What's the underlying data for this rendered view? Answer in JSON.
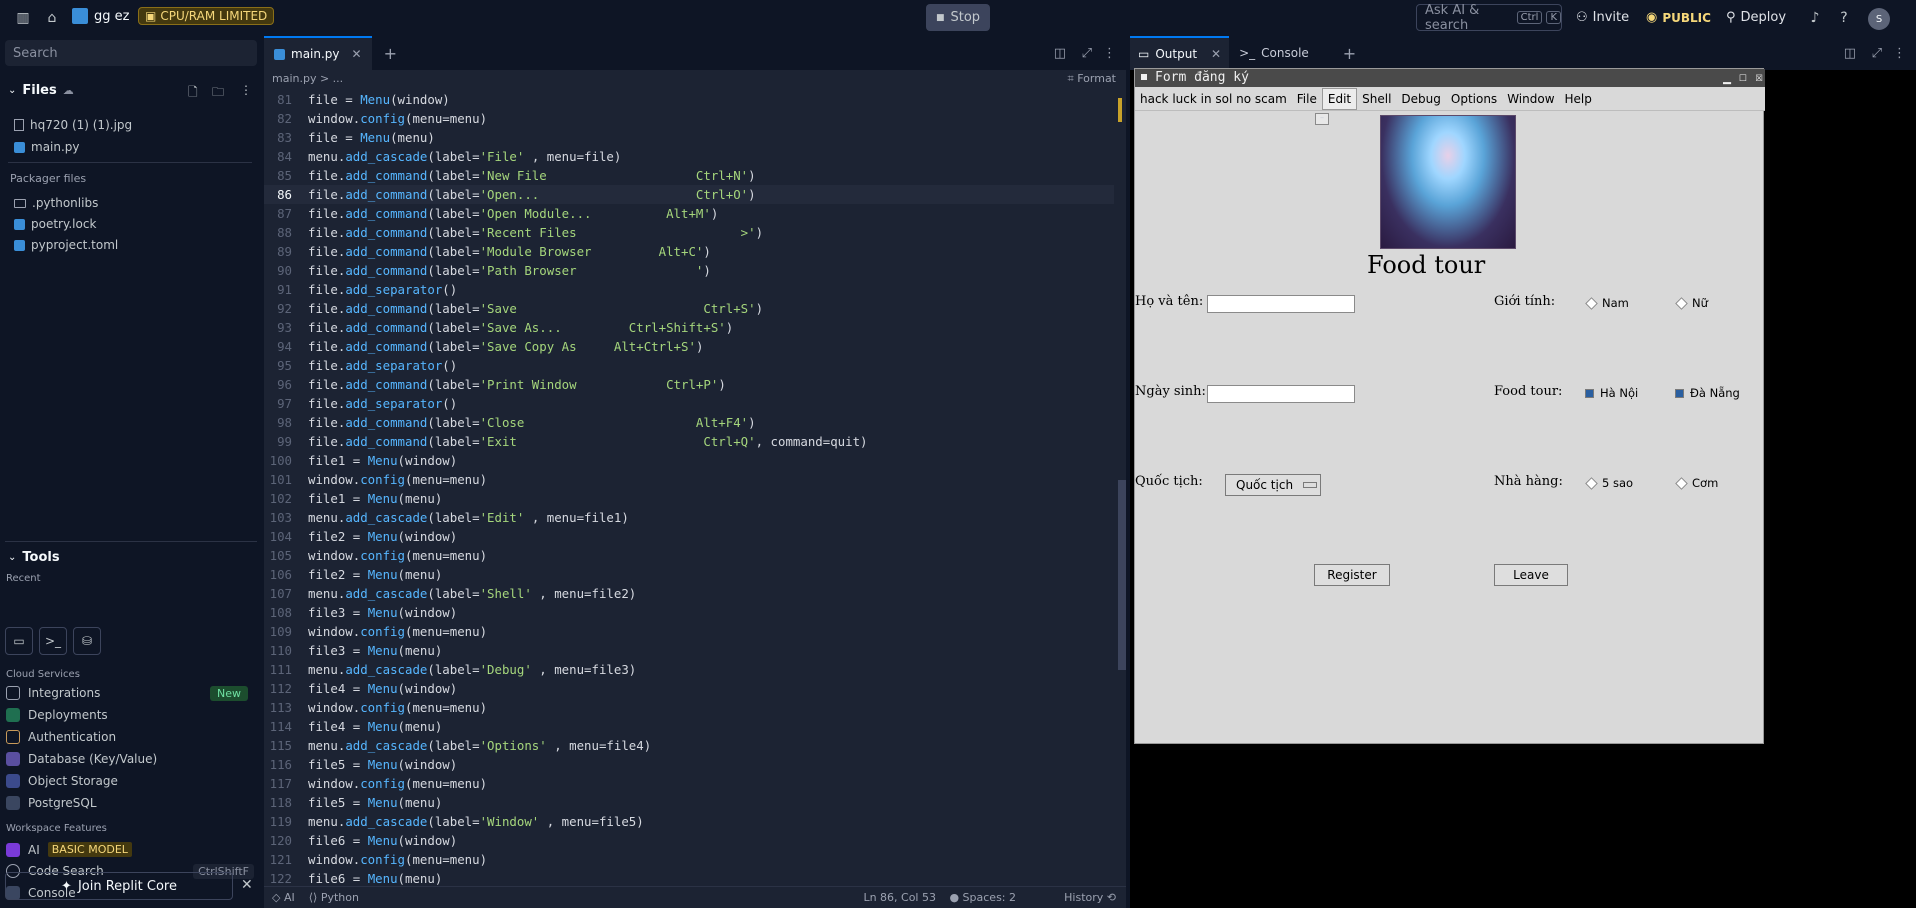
{
  "topbar": {
    "repl_name": "gg ez",
    "limit_badge": "CPU/RAM LIMITED",
    "stop_label": "Stop",
    "ask_placeholder": "Ask AI & search",
    "ask_kbd_ctrl": "Ctrl",
    "ask_kbd_k": "K",
    "invite_label": "Invite",
    "public_label": "PUBLIC",
    "deploy_label": "Deploy",
    "avatar_initials": "S"
  },
  "sidebar": {
    "search_placeholder": "Search",
    "files_title": "Files",
    "files": [
      "hq720 (1) (1).jpg",
      "main.py"
    ],
    "packager_title": "Packager files",
    "packager_files": [
      ".pythonlibs",
      "poetry.lock",
      "pyproject.toml"
    ],
    "tools_title": "Tools",
    "recent_label": "Recent",
    "cloud_title": "Cloud Services",
    "cloud": [
      "Integrations",
      "Deployments",
      "Authentication",
      "Database (Key/Value)",
      "Object Storage",
      "PostgreSQL"
    ],
    "new_badge": "New",
    "workspace_title": "Workspace Features",
    "ai_label": "AI",
    "basic_model": "BASIC MODEL",
    "code_search": "Code Search",
    "code_search_kbd": "CtrlShiftF",
    "console": "Console",
    "join_label": "Join Replit Core"
  },
  "editor": {
    "tab_label": "main.py",
    "breadcrumb": "main.py > ...",
    "format_label": "Format",
    "status_ai": "AI",
    "status_lang": "Python",
    "status_pos": "Ln 86, Col 53",
    "status_spaces": "Spaces: 2",
    "status_history": "History",
    "current_line": 86,
    "lines": [
      {
        "n": "81",
        "t": "file = Menu(window)"
      },
      {
        "n": "82",
        "t": "window.config(menu=menu)"
      },
      {
        "n": "83",
        "t": "file = Menu(menu)"
      },
      {
        "n": "84",
        "t": "menu.add_cascade(label='File' , menu=file)"
      },
      {
        "n": "85",
        "t": "file.add_command(label='New File                    Ctrl+N')"
      },
      {
        "n": "86",
        "t": "file.add_command(label='Open...                     Ctrl+O')"
      },
      {
        "n": "87",
        "t": "file.add_command(label='Open Module...          Alt+M')"
      },
      {
        "n": "88",
        "t": "file.add_command(label='Recent Files                      >')"
      },
      {
        "n": "89",
        "t": "file.add_command(label='Module Browser         Alt+C')"
      },
      {
        "n": "90",
        "t": "file.add_command(label='Path Browser                ')"
      },
      {
        "n": "91",
        "t": "file.add_separator()"
      },
      {
        "n": "92",
        "t": "file.add_command(label='Save                         Ctrl+S')"
      },
      {
        "n": "93",
        "t": "file.add_command(label='Save As...         Ctrl+Shift+S')"
      },
      {
        "n": "94",
        "t": "file.add_command(label='Save Copy As     Alt+Ctrl+S')"
      },
      {
        "n": "95",
        "t": "file.add_separator()"
      },
      {
        "n": "96",
        "t": "file.add_command(label='Print Window            Ctrl+P')"
      },
      {
        "n": "97",
        "t": "file.add_separator()"
      },
      {
        "n": "98",
        "t": "file.add_command(label='Close                       Alt+F4')"
      },
      {
        "n": "99",
        "t": "file.add_command(label='Exit                         Ctrl+Q', command=quit)"
      },
      {
        "n": "100",
        "t": "file1 = Menu(window)"
      },
      {
        "n": "101",
        "t": "window.config(menu=menu)"
      },
      {
        "n": "102",
        "t": "file1 = Menu(menu)"
      },
      {
        "n": "103",
        "t": "menu.add_cascade(label='Edit' , menu=file1)"
      },
      {
        "n": "104",
        "t": "file2 = Menu(window)"
      },
      {
        "n": "105",
        "t": "window.config(menu=menu)"
      },
      {
        "n": "106",
        "t": "file2 = Menu(menu)"
      },
      {
        "n": "107",
        "t": "menu.add_cascade(label='Shell' , menu=file2)"
      },
      {
        "n": "108",
        "t": "file3 = Menu(window)"
      },
      {
        "n": "109",
        "t": "window.config(menu=menu)"
      },
      {
        "n": "110",
        "t": "file3 = Menu(menu)"
      },
      {
        "n": "111",
        "t": "menu.add_cascade(label='Debug' , menu=file3)"
      },
      {
        "n": "112",
        "t": "file4 = Menu(window)"
      },
      {
        "n": "113",
        "t": "window.config(menu=menu)"
      },
      {
        "n": "114",
        "t": "file4 = Menu(menu)"
      },
      {
        "n": "115",
        "t": "menu.add_cascade(label='Options' , menu=file4)"
      },
      {
        "n": "116",
        "t": "file5 = Menu(window)"
      },
      {
        "n": "117",
        "t": "window.config(menu=menu)"
      },
      {
        "n": "118",
        "t": "file5 = Menu(menu)"
      },
      {
        "n": "119",
        "t": "menu.add_cascade(label='Window' , menu=file5)"
      },
      {
        "n": "120",
        "t": "file6 = Menu(window)"
      },
      {
        "n": "121",
        "t": "window.config(menu=menu)"
      },
      {
        "n": "122",
        "t": "file6 = Menu(menu)"
      }
    ]
  },
  "output": {
    "tab_output": "Output",
    "tab_console": "Console",
    "window_title": "Form đăng ký",
    "menu": [
      "hack luck in sol no scam",
      "File",
      "Edit",
      "Shell",
      "Debug",
      "Options",
      "Window",
      "Help"
    ],
    "active_menu": "Edit",
    "heading": "Food tour",
    "name_label": "Họ và tên:",
    "gender_label": "Giới tính:",
    "gender_options": [
      "Nam",
      "Nữ"
    ],
    "dob_label": "Ngày sinh:",
    "tour_label": "Food tour:",
    "tour_options": [
      "Hà Nội",
      "Đà Nẵng"
    ],
    "nationality_label": "Quốc tịch:",
    "nationality_value": "Quốc tịch",
    "restaurant_label": "Nhà hàng:",
    "restaurant_options": [
      "5 sao",
      "Cơm"
    ],
    "register_label": "Register",
    "leave_label": "Leave"
  },
  "colors": {
    "accent": "#0079f2",
    "limit": "#f5d77a",
    "string": "#a5d67c",
    "keyword": "#56b6ff"
  }
}
